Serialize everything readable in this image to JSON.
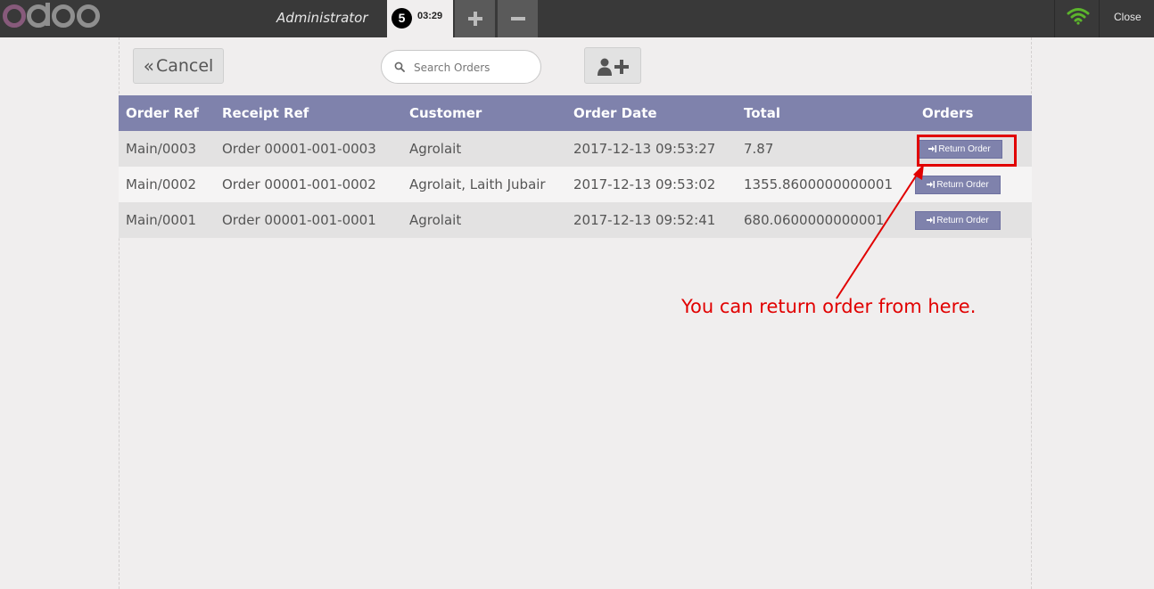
{
  "app": {
    "logo_text": "odoo"
  },
  "topbar": {
    "user_name": "Administrator",
    "order_tab": {
      "sequence": "5",
      "time": "03:29"
    },
    "add_order_icon": "plus-icon",
    "remove_order_icon": "minus-icon",
    "connection_icon": "wifi-icon",
    "connection_color": "#5cb52c",
    "close_label": "Close"
  },
  "toolbar": {
    "cancel_label": "Cancel",
    "cancel_icon": "double-chevron-left-icon",
    "search_placeholder": "Search Orders",
    "search_icon": "search-icon",
    "new_customer_icon": "user-plus-icon"
  },
  "table": {
    "headers": [
      "Order Ref",
      "Receipt Ref",
      "Customer",
      "Order Date",
      "Total",
      "Orders"
    ],
    "rows": [
      {
        "order_ref": "Main/0003",
        "receipt_ref": "Order 00001-001-0003",
        "customer": "Agrolait",
        "order_date": "2017-12-13 09:53:27",
        "total": "7.87",
        "action": "Return Order"
      },
      {
        "order_ref": "Main/0002",
        "receipt_ref": "Order 00001-001-0002",
        "customer": "Agrolait, Laith Jubair",
        "order_date": "2017-12-13 09:53:02",
        "total": "1355.8600000000001",
        "action": "Return Order"
      },
      {
        "order_ref": "Main/0001",
        "receipt_ref": "Order 00001-001-0001",
        "customer": "Agrolait",
        "order_date": "2017-12-13 09:52:41",
        "total": "680.0600000000001",
        "action": "Return Order"
      }
    ]
  },
  "annotation": {
    "text": "You can return order from here.",
    "color": "#e10000"
  },
  "colors": {
    "header_bg": "#7f82ac",
    "topbar_bg": "#393939",
    "logo_purple": "#875a7b",
    "logo_grey": "#8f8f8f"
  }
}
